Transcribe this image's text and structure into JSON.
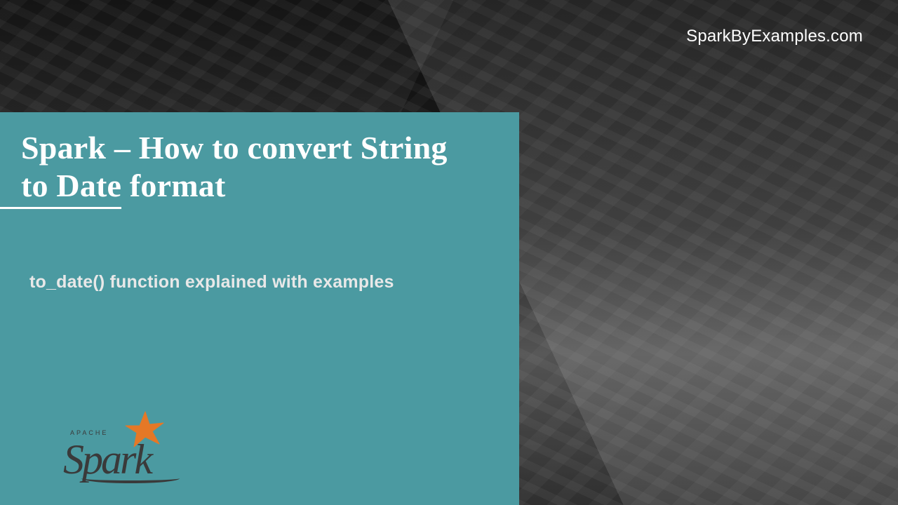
{
  "watermark": "SparkByExamples.com",
  "title_line1": "Spark – How to convert String",
  "title_line2_underlined": " to Date",
  "title_line2_rest": " format",
  "subtitle": "to_date() function explained with examples",
  "logo": {
    "apache": "APACHE",
    "name": "Spark"
  }
}
